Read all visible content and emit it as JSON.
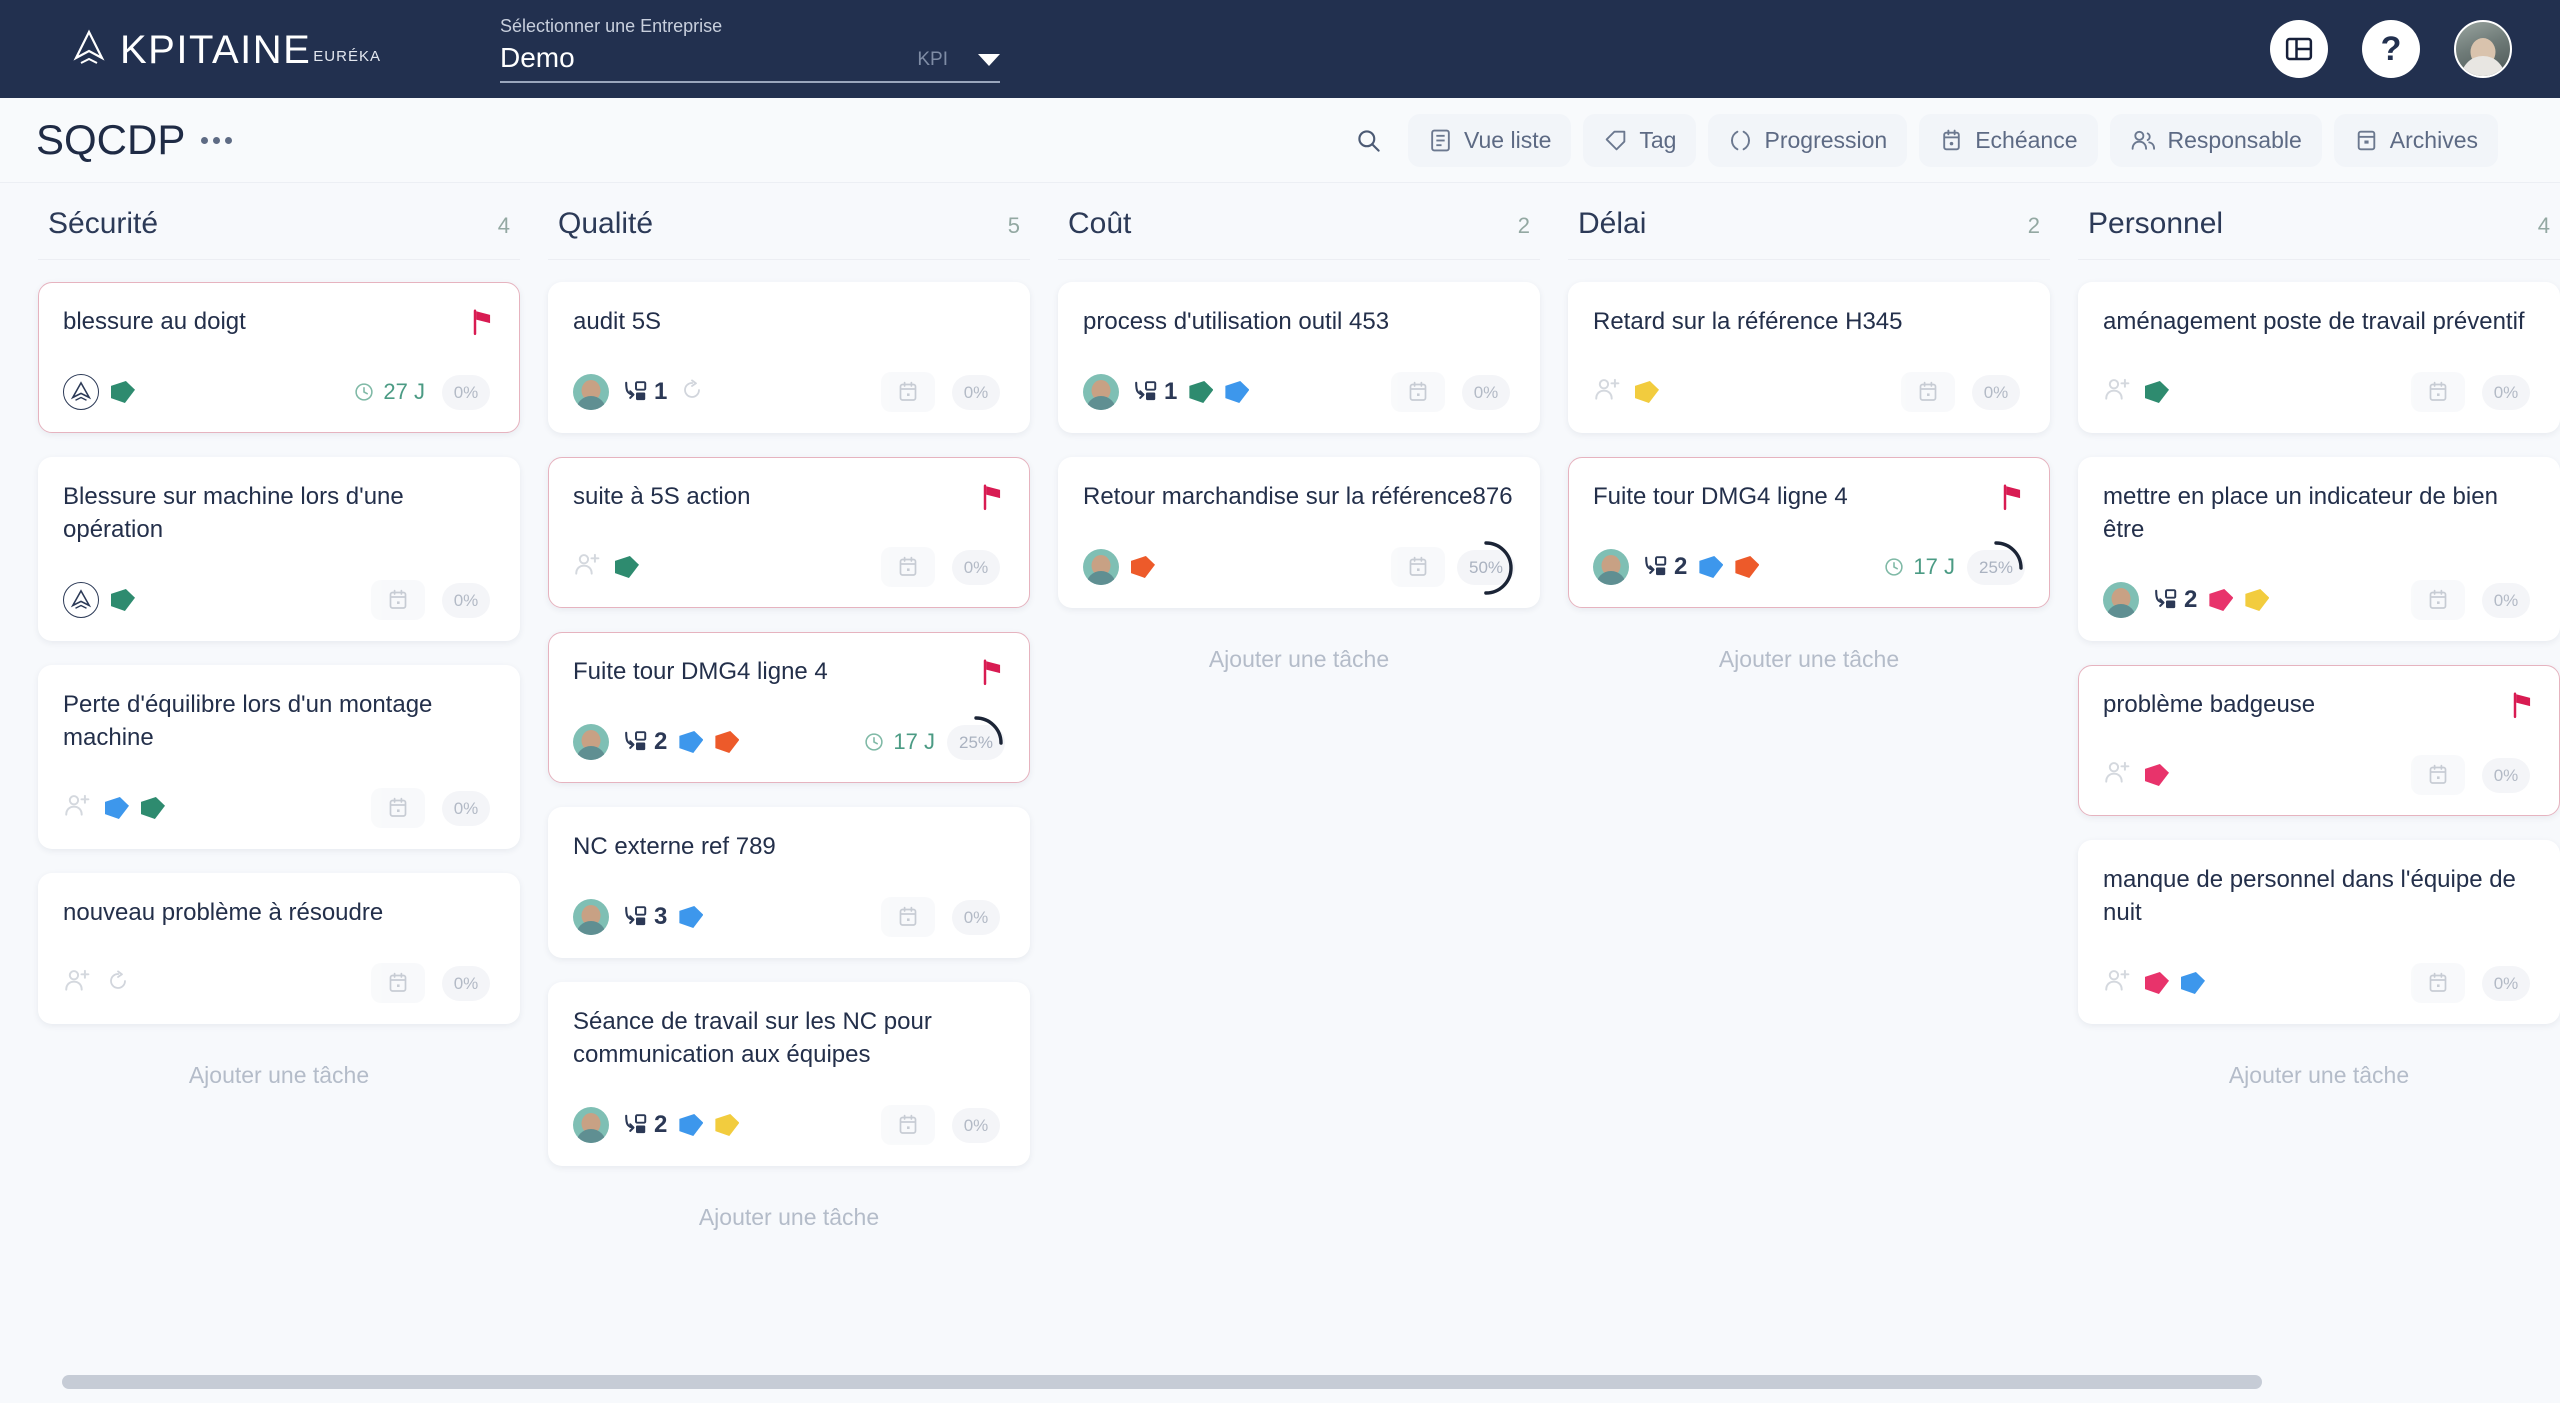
{
  "header": {
    "brand_name": "KPITAINE",
    "brand_suffix": "EURÉKA",
    "company_label": "Sélectionner une Entreprise",
    "company_value": "Demo",
    "company_kpi": "KPI",
    "layout_icon": "layout-panel-icon",
    "help_icon": "help-question-icon",
    "avatar_icon": "user-avatar"
  },
  "subbar": {
    "page_title": "SQCDP",
    "menu_icon": "more-options-icon",
    "tools": [
      {
        "label": "",
        "icon": "search-icon",
        "name": "search-button"
      },
      {
        "label": "Vue liste",
        "icon": "list-view-icon",
        "name": "list-view-button"
      },
      {
        "label": "Tag",
        "icon": "tag-icon",
        "name": "tag-filter-button"
      },
      {
        "label": "Progression",
        "icon": "progress-icon",
        "name": "progression-button"
      },
      {
        "label": "Echéance",
        "icon": "calendar-icon",
        "name": "echeance-button"
      },
      {
        "label": "Responsable",
        "icon": "people-icon",
        "name": "responsable-button"
      },
      {
        "label": "Archives",
        "icon": "archive-icon",
        "name": "archives-button"
      }
    ]
  },
  "board": {
    "add_task_label": "Ajouter une tâche",
    "colors": {
      "green": "#2e8b6f",
      "blue": "#3d97ec",
      "orange": "#ed5a2a",
      "yellow": "#f2cc3e",
      "pink": "#e8336b",
      "flag_red": "#d81b52",
      "accent_navy": "#22304f"
    },
    "columns": [
      {
        "title": "Sécurité",
        "count": "4",
        "cards": [
          {
            "title": "blessure au doigt",
            "flagged": true,
            "avatar": "logo",
            "subtasks": "",
            "tags": [
              "green"
            ],
            "due": "27 J",
            "percent": "0%",
            "progress": 0,
            "has_date_chip": false
          },
          {
            "title": "Blessure sur machine lors d'une opération",
            "flagged": false,
            "avatar": "logo",
            "subtasks": "",
            "tags": [
              "green"
            ],
            "due": "",
            "percent": "0%",
            "progress": 0,
            "has_date_chip": true
          },
          {
            "title": "Perte d'équilibre lors d'un montage machine",
            "flagged": false,
            "avatar": "add",
            "subtasks": "",
            "tags": [
              "blue",
              "green"
            ],
            "due": "",
            "percent": "0%",
            "progress": 0,
            "has_date_chip": true
          },
          {
            "title": "nouveau problème à résoudre",
            "flagged": false,
            "avatar": "add",
            "subtasks": "",
            "tags": [],
            "repeat": true,
            "due": "",
            "percent": "0%",
            "progress": 0,
            "has_date_chip": true
          }
        ]
      },
      {
        "title": "Qualité",
        "count": "5",
        "cards": [
          {
            "title": "audit 5S",
            "flagged": false,
            "avatar": "photo",
            "subtasks": "1",
            "tags": [],
            "repeat": true,
            "due": "",
            "percent": "0%",
            "progress": 0,
            "has_date_chip": true
          },
          {
            "title": "suite à 5S action",
            "flagged": true,
            "avatar": "add",
            "subtasks": "",
            "tags": [
              "green"
            ],
            "due": "",
            "percent": "0%",
            "progress": 0,
            "has_date_chip": true
          },
          {
            "title": "Fuite tour DMG4 ligne 4",
            "flagged": true,
            "avatar": "photo",
            "subtasks": "2",
            "tags": [
              "blue",
              "orange"
            ],
            "due": "17 J",
            "percent": "25%",
            "progress": 25,
            "has_date_chip": false
          },
          {
            "title": "NC externe ref 789",
            "flagged": false,
            "avatar": "photo",
            "subtasks": "3",
            "tags": [
              "blue"
            ],
            "due": "",
            "percent": "0%",
            "progress": 0,
            "has_date_chip": true
          },
          {
            "title": "Séance de travail sur les NC pour communication aux équipes",
            "flagged": false,
            "avatar": "photo",
            "subtasks": "2",
            "tags": [
              "blue",
              "yellow"
            ],
            "due": "",
            "percent": "0%",
            "progress": 0,
            "has_date_chip": true
          }
        ]
      },
      {
        "title": "Coût",
        "count": "2",
        "cards": [
          {
            "title": "process d'utilisation outil 453",
            "flagged": false,
            "avatar": "photo",
            "subtasks": "1",
            "tags": [
              "green",
              "blue"
            ],
            "due": "",
            "percent": "0%",
            "progress": 0,
            "has_date_chip": true
          },
          {
            "title": "Retour marchandise sur la référence876",
            "flagged": false,
            "avatar": "photo",
            "subtasks": "",
            "tags": [
              "orange"
            ],
            "due": "",
            "percent": "50%",
            "progress": 50,
            "has_date_chip": true
          }
        ]
      },
      {
        "title": "Délai",
        "count": "2",
        "cards": [
          {
            "title": "Retard sur la référence H345",
            "flagged": false,
            "avatar": "add",
            "subtasks": "",
            "tags": [
              "yellow"
            ],
            "due": "",
            "percent": "0%",
            "progress": 0,
            "has_date_chip": true
          },
          {
            "title": "Fuite tour DMG4 ligne 4",
            "flagged": true,
            "avatar": "photo",
            "subtasks": "2",
            "tags": [
              "blue",
              "orange"
            ],
            "due": "17 J",
            "percent": "25%",
            "progress": 25,
            "has_date_chip": false
          }
        ]
      },
      {
        "title": "Personnel",
        "count": "4",
        "cards": [
          {
            "title": "aménagement poste de travail préventif",
            "flagged": false,
            "avatar": "add",
            "subtasks": "",
            "tags": [
              "green"
            ],
            "due": "",
            "percent": "0%",
            "progress": 0,
            "has_date_chip": true
          },
          {
            "title": "mettre en place un indicateur de bien être",
            "flagged": false,
            "avatar": "photo",
            "subtasks": "2",
            "tags": [
              "pink",
              "yellow"
            ],
            "due": "",
            "percent": "0%",
            "progress": 0,
            "has_date_chip": true
          },
          {
            "title": "problème badgeuse",
            "flagged": true,
            "avatar": "add",
            "subtasks": "",
            "tags": [
              "pink"
            ],
            "due": "",
            "percent": "0%",
            "progress": 0,
            "has_date_chip": true
          },
          {
            "title": "manque de personnel dans l'équipe de nuit",
            "flagged": false,
            "avatar": "add",
            "subtasks": "",
            "tags": [
              "pink",
              "blue"
            ],
            "due": "",
            "percent": "0%",
            "progress": 0,
            "has_date_chip": true
          }
        ]
      }
    ]
  }
}
